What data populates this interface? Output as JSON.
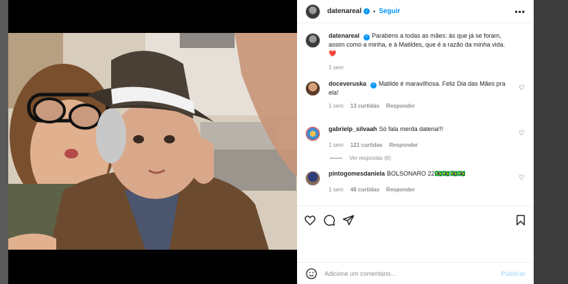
{
  "post": {
    "author": "datenareal",
    "follow_label": "Seguir",
    "separator": "•",
    "more_label": "•••"
  },
  "caption": {
    "author": "datenareal",
    "text": "Parabéns a todas as mães: às que já se foram, assim como a minha, e à Matildes, que é a razão da minha vida. ❤️",
    "time": "1 sem"
  },
  "comments": [
    {
      "author": "doceveruska",
      "verified": true,
      "text": "Matilde é maravilhosa. Feliz Dia das Mães pra ela!",
      "time": "1 sem",
      "likes": "13 curtidas",
      "reply": "Responder"
    },
    {
      "author": "gabrielp_silvaah",
      "verified": false,
      "text": "Só fala merda datena!!!",
      "time": "1 sem",
      "likes": "121 curtidas",
      "reply": "Responder",
      "view_replies": "Ver respostas (6)"
    },
    {
      "author": "pintogomesdaniela",
      "verified": false,
      "text": "BOLSONARO 22🇧🇷🇧🇷🇧🇷🇧🇷",
      "time": "1 sem",
      "likes": "48 curtidas",
      "reply": "Responder"
    }
  ],
  "compose": {
    "placeholder": "Adicione um comentário...",
    "publish_label": "Publicar"
  },
  "icons": {
    "like": "heart-icon",
    "comment": "comment-icon",
    "share": "share-icon",
    "save": "bookmark-icon",
    "emoji": "emoji-icon",
    "verified": "verified-badge-icon"
  },
  "colors": {
    "accent": "#0095f6",
    "muted": "#8e8e8e",
    "heart": "#ed4956"
  }
}
